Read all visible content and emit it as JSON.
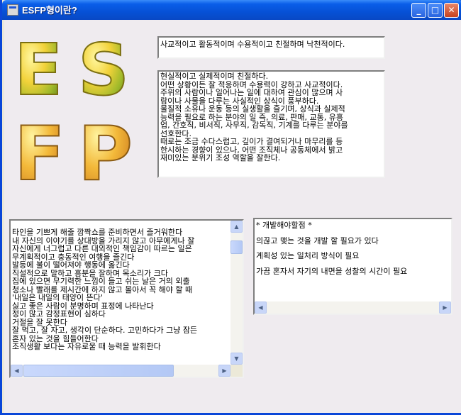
{
  "window": {
    "title": "ESFP형이란?",
    "minimize_label": "_",
    "maximize_label": "□",
    "close_label": "✕"
  },
  "logo": {
    "letters": [
      "E",
      "S",
      "F",
      "P"
    ]
  },
  "summary": {
    "text": "사교적이고 활동적이며 수용적이고 친절하며 낙천적이다."
  },
  "description": {
    "lines": [
      "현실적이고 실제적이며 친절하다.",
      "어떤 상황이든 잘 적응하며 수용력이 강하고 사교적이다.",
      "주위의 사람이나 일어나는 일에 대하여 관심이 많으며 사",
      "람이나 사물을 다루는 사실적인 상식이 풍부하다.",
      "물질적 소유나 운동 등의 실생활을 즐기며, 상식과 실제적",
      "능력을 필요로 하는 분야의 일 즉, 의료, 판매, 교통, 유흥",
      "업, 간호직, 비서직, 사무직, 감독직, 기계를 다루는 분야를",
      "선호한다.",
      "때로는 조금 수다스럽고, 깊이가 결여되거나 마무리를 등",
      "한시하는 경향이 있으나, 어떤 조직체나 공동체에서 밝고",
      "재미있는 분위기 조성 역할을 잘한다."
    ]
  },
  "traits": {
    "lines": [
      "타인을 기쁘게 해줄 깜짝쇼를 준비하면서 즐거워한다",
      "내 자신의 이야기를 상대방을 가리지 않고 아무에게나 잘",
      "자신에게 너그럽고 다른 대외적인 책임감이 따르는 일은",
      "무계획적이고 충동적인 여행을 즐긴다",
      "발등에 불이 떨어져야 행동에 옮긴다",
      "직설적으로 말하고 흥분을 잘하며 목소리가 크다",
      "집에 있으면 무기력한 느낌이 들고 쉬는 날은 거의 외출",
      "청소나 빨래를 제시간에 하지 않고 몰아서 꼭 해야 할 때",
      "'내일은 내일의 태양이 뜬다'",
      "싫고 좋은 사람이 분명하며 표정에 나타난다",
      "정이 많고 감정표현이 심하다",
      "거절을 잘 못한다",
      "잘 먹고, 잘 자고, 생각이 단순하다. 고민하다가 그냥 잠든",
      "혼자 있는 것을 힘들어한다",
      "조직생활 보다는 자유로울 때 능력을 발휘한다"
    ]
  },
  "development": {
    "title": "* 개발해야할점 *",
    "items": [
      "의끊고 맺는 것을 개발 할 필요가 있다",
      "계획성 있는 일처리 방식이 필요",
      "가끔 혼자서 자기의 내면을 성찰의 시간이 필요"
    ]
  },
  "icons": {
    "scroll_up": "scroll-up-arrow-icon",
    "scroll_down": "scroll-down-arrow-icon",
    "scroll_left": "scroll-left-arrow-icon",
    "scroll_right": "scroll-right-arrow-icon"
  }
}
